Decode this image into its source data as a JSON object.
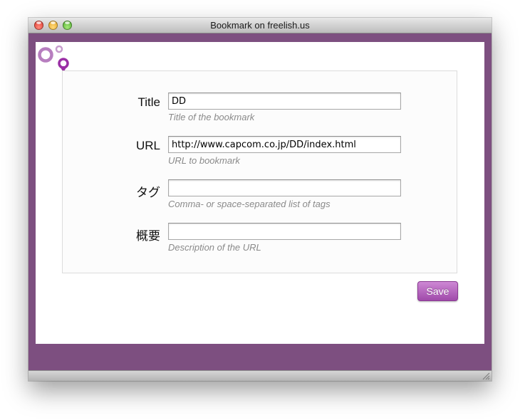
{
  "window": {
    "title": "Bookmark on freelish.us"
  },
  "brand": {
    "logo_icon": "freelish-logo-icon",
    "accent_color": "#7d4f80",
    "logo_color": "#a05aa8"
  },
  "form": {
    "fields": [
      {
        "label": "Title",
        "value": "DD",
        "placeholder": "",
        "hint": "Title of the bookmark"
      },
      {
        "label": "URL",
        "value": "http://www.capcom.co.jp/DD/index.html",
        "placeholder": "",
        "hint": "URL to bookmark"
      },
      {
        "label": "タグ",
        "value": "",
        "placeholder": "",
        "hint": "Comma- or space-separated list of tags"
      },
      {
        "label": "概要",
        "value": "",
        "placeholder": "",
        "hint": "Description of the URL"
      }
    ],
    "save_label": "Save"
  }
}
